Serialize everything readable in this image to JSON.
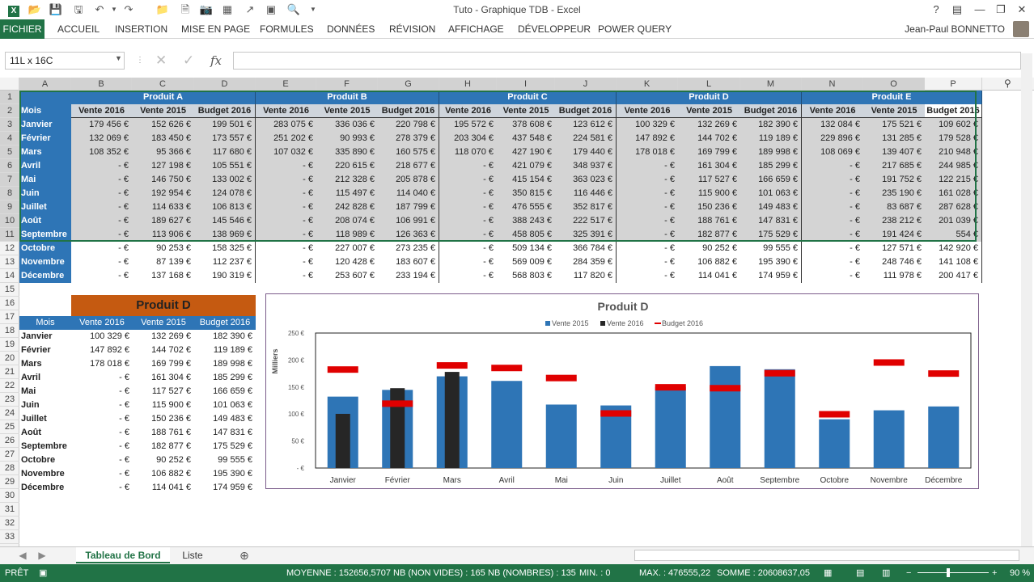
{
  "window": {
    "title": "Tuto - Graphique TDB - Excel"
  },
  "ribbon": {
    "file": "FICHIER",
    "tabs": [
      "ACCUEIL",
      "INSERTION",
      "MISE EN PAGE",
      "FORMULES",
      "DONNÉES",
      "RÉVISION",
      "AFFICHAGE",
      "DÉVELOPPEUR",
      "POWER QUERY"
    ],
    "user": "Jean-Paul BONNETTO"
  },
  "formula": {
    "namebox": "11L x 16C",
    "fx": "fx",
    "value": ""
  },
  "columns": [
    "A",
    "B",
    "C",
    "D",
    "E",
    "F",
    "G",
    "H",
    "I",
    "J",
    "K",
    "L",
    "M",
    "N",
    "O",
    "P"
  ],
  "rows": [
    "1",
    "2",
    "3",
    "4",
    "5",
    "6",
    "7",
    "8",
    "9",
    "10",
    "11",
    "12",
    "13",
    "14",
    "15",
    "16",
    "17",
    "18",
    "19",
    "20",
    "21",
    "22",
    "23",
    "24",
    "25",
    "26",
    "27",
    "28",
    "29",
    "30",
    "31",
    "32",
    "33"
  ],
  "table": {
    "products": [
      "Produit A",
      "Produit B",
      "Produit C",
      "Produit D",
      "Produit E"
    ],
    "month_header": "Mois",
    "sub_headers": [
      "Vente 2016",
      "Vente 2015",
      "Budget 2016"
    ],
    "months": [
      "Janvier",
      "Février",
      "Mars",
      "Avril",
      "Mai",
      "Juin",
      "Juillet",
      "Août",
      "Septembre",
      "Octobre",
      "Novembre",
      "Décembre"
    ],
    "data": [
      [
        "179 456 €",
        "152 626 €",
        "199 501 €",
        "283 075 €",
        "336 036 €",
        "220 798 €",
        "195 572 €",
        "378 608 €",
        "123 612 €",
        "100 329 €",
        "132 269 €",
        "182 390 €",
        "132 084 €",
        "175 521 €",
        "109 602 €"
      ],
      [
        "132 069 €",
        "183 450 €",
        "173 557 €",
        "251 202 €",
        "90 993 €",
        "278 379 €",
        "203 304 €",
        "437 548 €",
        "224 581 €",
        "147 892 €",
        "144 702 €",
        "119 189 €",
        "229 896 €",
        "131 285 €",
        "179 528 €"
      ],
      [
        "108 352 €",
        "95 366 €",
        "117 680 €",
        "107 032 €",
        "335 890 €",
        "160 575 €",
        "118 070 €",
        "427 190 €",
        "179 440 €",
        "178 018 €",
        "169 799 €",
        "189 998 €",
        "108 069 €",
        "139 407 €",
        "210 948 €"
      ],
      [
        "-   €",
        "127 198 €",
        "105 551 €",
        "-   €",
        "220 615 €",
        "218 677 €",
        "-   €",
        "421 079 €",
        "348 937 €",
        "-   €",
        "161 304 €",
        "185 299 €",
        "-   €",
        "217 685 €",
        "244 985 €"
      ],
      [
        "-   €",
        "146 750 €",
        "133 002 €",
        "-   €",
        "212 328 €",
        "205 878 €",
        "-   €",
        "415 154 €",
        "363 023 €",
        "-   €",
        "117 527 €",
        "166 659 €",
        "-   €",
        "191 752 €",
        "122 215 €"
      ],
      [
        "-   €",
        "192 954 €",
        "124 078 €",
        "-   €",
        "115 497 €",
        "114 040 €",
        "-   €",
        "350 815 €",
        "116 446 €",
        "-   €",
        "115 900 €",
        "101 063 €",
        "-   €",
        "235 190 €",
        "161 028 €"
      ],
      [
        "-   €",
        "114 633 €",
        "106 813 €",
        "-   €",
        "242 828 €",
        "187 799 €",
        "-   €",
        "476 555 €",
        "352 817 €",
        "-   €",
        "150 236 €",
        "149 483 €",
        "-   €",
        "83 687 €",
        "287 628 €"
      ],
      [
        "-   €",
        "189 627 €",
        "145 546 €",
        "-   €",
        "208 074 €",
        "106 991 €",
        "-   €",
        "388 243 €",
        "222 517 €",
        "-   €",
        "188 761 €",
        "147 831 €",
        "-   €",
        "238 212 €",
        "201 039 €"
      ],
      [
        "-   €",
        "113 906 €",
        "138 969 €",
        "-   €",
        "118 989 €",
        "126 363 €",
        "-   €",
        "458 805 €",
        "325 391 €",
        "-   €",
        "182 877 €",
        "175 529 €",
        "-   €",
        "191 424 €",
        "554 €"
      ],
      [
        "-   €",
        "90 253 €",
        "158 325 €",
        "-   €",
        "227 007 €",
        "273 235 €",
        "-   €",
        "509 134 €",
        "366 784 €",
        "-   €",
        "90 252 €",
        "99 555 €",
        "-   €",
        "127 571 €",
        "142 920 €"
      ],
      [
        "-   €",
        "87 139 €",
        "112 237 €",
        "-   €",
        "120 428 €",
        "183 607 €",
        "-   €",
        "569 009 €",
        "284 359 €",
        "-   €",
        "106 882 €",
        "195 390 €",
        "-   €",
        "248 746 €",
        "141 108 €"
      ],
      [
        "-   €",
        "137 168 €",
        "190 319 €",
        "-   €",
        "253 607 €",
        "233 194 €",
        "-   €",
        "568 803 €",
        "117 820 €",
        "-   €",
        "114 041 €",
        "174 959 €",
        "-   €",
        "111 978 €",
        "200 417 €"
      ]
    ]
  },
  "summary": {
    "title": "Produit D",
    "headers": [
      "Mois",
      "Vente 2016",
      "Vente 2015",
      "Budget 2016"
    ],
    "rows": [
      [
        "Janvier",
        "100 329 €",
        "132 269 €",
        "182 390 €"
      ],
      [
        "Février",
        "147 892 €",
        "144 702 €",
        "119 189 €"
      ],
      [
        "Mars",
        "178 018 €",
        "169 799 €",
        "189 998 €"
      ],
      [
        "Avril",
        "-   €",
        "161 304 €",
        "185 299 €"
      ],
      [
        "Mai",
        "-   €",
        "117 527 €",
        "166 659 €"
      ],
      [
        "Juin",
        "-   €",
        "115 900 €",
        "101 063 €"
      ],
      [
        "Juillet",
        "-   €",
        "150 236 €",
        "149 483 €"
      ],
      [
        "Août",
        "-   €",
        "188 761 €",
        "147 831 €"
      ],
      [
        "Septembre",
        "-   €",
        "182 877 €",
        "175 529 €"
      ],
      [
        "Octobre",
        "-   €",
        "90 252 €",
        "99 555 €"
      ],
      [
        "Novembre",
        "-   €",
        "106 882 €",
        "195 390 €"
      ],
      [
        "Décembre",
        "-   €",
        "114 041 €",
        "174 959 €"
      ]
    ]
  },
  "chart_data": {
    "type": "bar",
    "title": "Produit D",
    "ylabel": "Milliers",
    "categories": [
      "Janvier",
      "Février",
      "Mars",
      "Avril",
      "Mai",
      "Juin",
      "Juillet",
      "Août",
      "Septembre",
      "Octobre",
      "Novembre",
      "Décembre"
    ],
    "ylim": [
      0,
      250
    ],
    "yticks": [
      "- €",
      "50 €",
      "100 €",
      "150 €",
      "200 €",
      "250 €"
    ],
    "series": [
      {
        "name": "Vente 2015",
        "color": "#2e75b6",
        "values": [
          132.269,
          144.702,
          169.799,
          161.304,
          117.527,
          115.9,
          150.236,
          188.761,
          182.877,
          90.252,
          106.882,
          114.041
        ]
      },
      {
        "name": "Vente 2016",
        "color": "#262626",
        "values": [
          100.329,
          147.892,
          178.018,
          0,
          0,
          0,
          0,
          0,
          0,
          0,
          0,
          0
        ]
      },
      {
        "name": "Budget 2016",
        "color": "#e00000",
        "values": [
          182.39,
          119.189,
          189.998,
          185.299,
          166.659,
          101.063,
          149.483,
          147.831,
          175.529,
          99.555,
          195.39,
          174.959
        ]
      }
    ],
    "legend": "top"
  },
  "sheets": {
    "tabs": [
      "Tableau de Bord",
      "Liste"
    ],
    "active": "Tableau de Bord"
  },
  "status": {
    "ready": "PRÊT",
    "moyenne": "MOYENNE : 152656,5707",
    "nbnonvides": "NB (NON VIDES) : 165",
    "nbnombres": "NB (NOMBRES) : 135",
    "min": "MIN. : 0",
    "max": "MAX. : 476555,22",
    "somme": "SOMME : 20608637,05",
    "zoom": "90 %"
  }
}
